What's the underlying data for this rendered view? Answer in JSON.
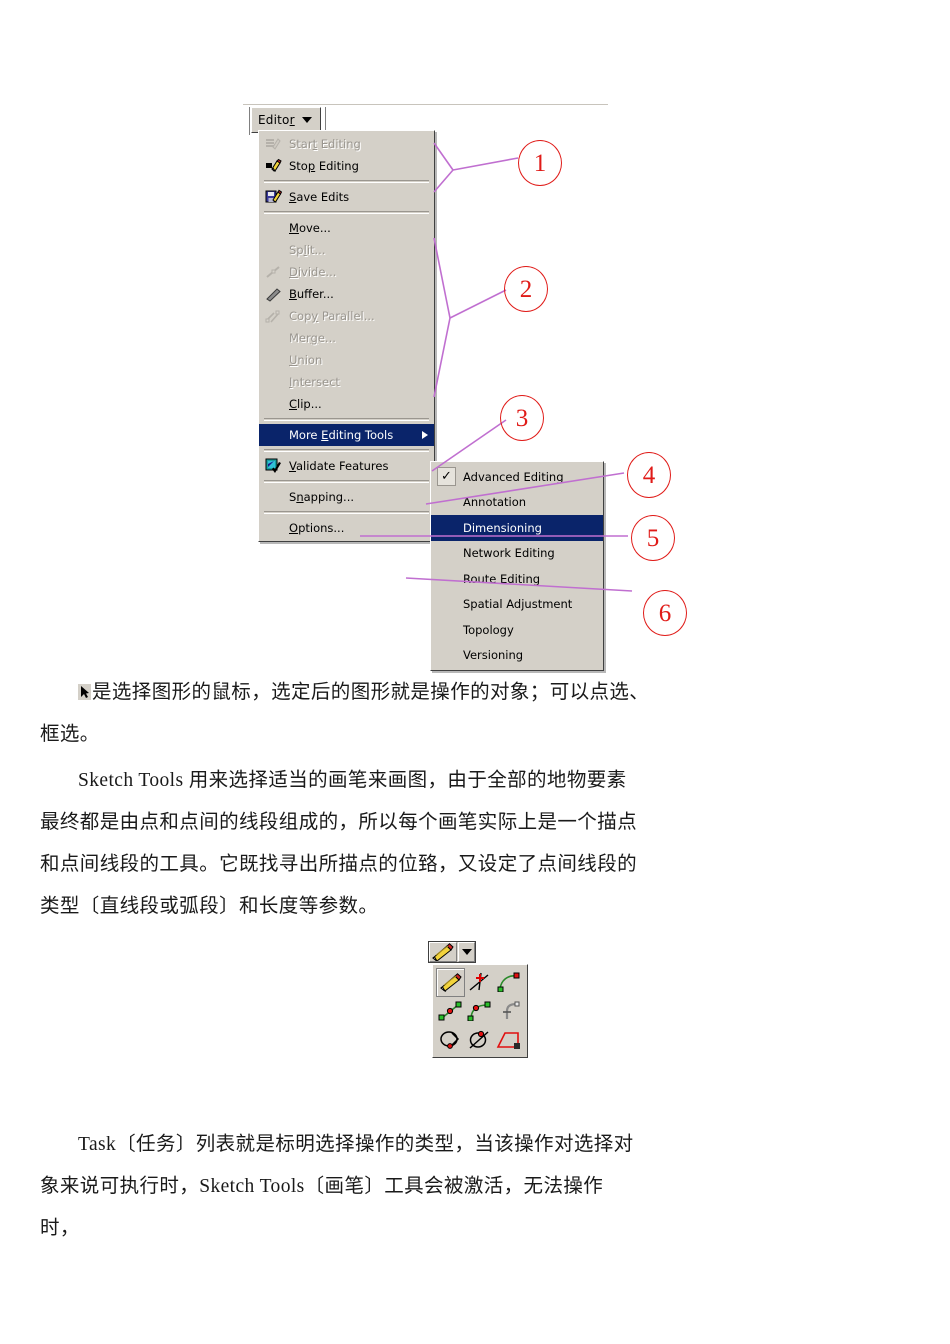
{
  "figure": {
    "toolbar": {
      "editor_button_label": "Editor",
      "editor_button_accesskey": "r",
      "dropdown_icon": "chevron-down-icon"
    },
    "editor_menu": {
      "items": [
        {
          "label": "Start Editing",
          "accesskey": "t",
          "state": "disabled",
          "icon": "start-editing-icon",
          "separator_after": false
        },
        {
          "label": "Stop Editing",
          "accesskey": "p",
          "state": "enabled",
          "icon": "stop-editing-icon",
          "separator_after": true
        },
        {
          "label": "Save Edits",
          "accesskey": "S",
          "state": "enabled",
          "icon": "save-edits-icon",
          "separator_after": true
        },
        {
          "label": "Move...",
          "accesskey": "M",
          "state": "enabled",
          "icon": "",
          "separator_after": false
        },
        {
          "label": "Split...",
          "accesskey": "l",
          "state": "disabled",
          "icon": "",
          "separator_after": false
        },
        {
          "label": "Divide...",
          "accesskey": "D",
          "state": "disabled",
          "icon": "divide-icon",
          "separator_after": false
        },
        {
          "label": "Buffer...",
          "accesskey": "B",
          "state": "enabled",
          "icon": "buffer-icon",
          "separator_after": false
        },
        {
          "label": "Copy Parallel...",
          "accesskey": "y",
          "state": "disabled",
          "icon": "copy-parallel-icon",
          "separator_after": false
        },
        {
          "label": "Merge...",
          "accesskey": "g",
          "state": "disabled",
          "icon": "",
          "separator_after": false
        },
        {
          "label": "Union",
          "accesskey": "U",
          "state": "disabled",
          "icon": "",
          "separator_after": false
        },
        {
          "label": "Intersect",
          "accesskey": "I",
          "state": "disabled",
          "icon": "",
          "separator_after": false
        },
        {
          "label": "Clip...",
          "accesskey": "C",
          "state": "enabled",
          "icon": "",
          "separator_after": true
        },
        {
          "label": "More Editing Tools",
          "accesskey": "E",
          "state": "highlighted",
          "icon": "",
          "submenu_arrow": "submenu-arrow-icon",
          "separator_after": true
        },
        {
          "label": "Validate Features",
          "accesskey": "V",
          "state": "enabled",
          "icon": "validate-features-icon",
          "separator_after": true
        },
        {
          "label": "Snapping...",
          "accesskey": "n",
          "state": "enabled",
          "icon": "",
          "separator_after": true
        },
        {
          "label": "Options...",
          "accesskey": "O",
          "state": "enabled",
          "icon": "",
          "separator_after": false
        }
      ]
    },
    "more_editing_tools_submenu": {
      "items": [
        {
          "label": "Advanced Editing",
          "checked": true,
          "selected": false
        },
        {
          "label": "Annotation",
          "checked": false,
          "selected": false
        },
        {
          "label": "Dimensioning",
          "checked": false,
          "selected": true
        },
        {
          "label": "Network Editing",
          "checked": false,
          "selected": false
        },
        {
          "label": "Route Editing",
          "checked": false,
          "selected": false
        },
        {
          "label": "Spatial Adjustment",
          "checked": false,
          "selected": false
        },
        {
          "label": "Topology",
          "checked": false,
          "selected": false
        },
        {
          "label": "Versioning",
          "checked": false,
          "selected": false
        }
      ]
    },
    "callouts": [
      {
        "number": "1"
      },
      {
        "number": "2"
      },
      {
        "number": "3"
      },
      {
        "number": "4"
      },
      {
        "number": "5"
      },
      {
        "number": "6"
      }
    ],
    "colors": {
      "menu_background": "#d4d0c8",
      "menu_highlight": "#0a246a",
      "callout_red": "#e01b18",
      "leader_line_magenta": "#c06fd0"
    }
  },
  "sketch_palette": {
    "toolbar_main_icon": "pencil-sketch-icon",
    "toolbar_dropdown_icon": "chevron-down-icon",
    "tools": [
      {
        "name": "sketch-tool-icon",
        "active": true
      },
      {
        "name": "intersection-tool-icon",
        "active": false
      },
      {
        "name": "arc-tool-icon",
        "active": false
      },
      {
        "name": "midpoint-tool-icon",
        "active": false
      },
      {
        "name": "endpoint-arc-tool-icon",
        "active": false
      },
      {
        "name": "tangent-curve-tool-icon",
        "active": false
      },
      {
        "name": "trace-tool-icon",
        "active": false
      },
      {
        "name": "distance-distance-tool-icon",
        "active": false
      },
      {
        "name": "direction-distance-tool-icon",
        "active": false
      }
    ]
  },
  "body": {
    "p1": "是选择图形的鼠标，选定后的图形就是操作的对象；可以点选、",
    "p1_line2": "框选。",
    "p2": "Sketch Tools 用来选择适当的画笔来画图，由于全部的地物要素",
    "p2_line2": "最终都是由点和点间的线段组成的，所以每个画笔实际上是一个描点",
    "p2_line3": "和点间线段的工具。它既找寻出所描点的位臵，又设定了点间线段的",
    "p2_line4": "类型〔直线段或弧段〕和长度等参数。",
    "p3": "Task〔任务〕列表就是标明选择操作的类型，当该操作对选择对",
    "p3_line2": "象来说可执行时，Sketch Tools〔画笔〕工具会被激活，无法操作",
    "p3_line3": "时，"
  }
}
